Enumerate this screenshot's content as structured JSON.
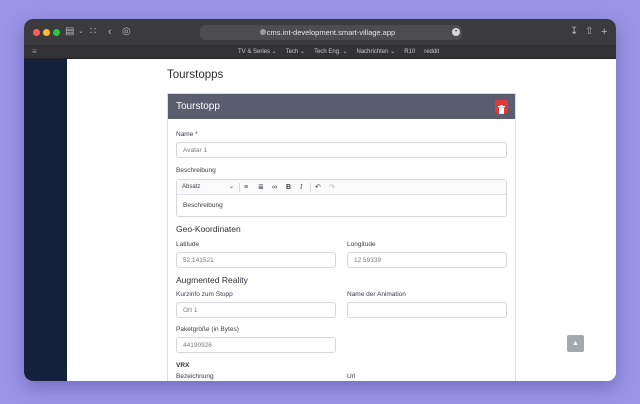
{
  "browser": {
    "url": "cms.int-development.smart-village.app",
    "bookmarks": [
      {
        "label": "TV & Series ⌄"
      },
      {
        "label": "Tech ⌄"
      },
      {
        "label": "Tech Eng. ⌄"
      },
      {
        "label": "Nachrichten ⌄"
      },
      {
        "label": "R10"
      },
      {
        "label": "reddit"
      }
    ]
  },
  "page": {
    "title": "Tourstopps"
  },
  "card": {
    "title": "Tourstopp",
    "name_label": "Name *",
    "name_value": "Avatar 1",
    "beschreibung_label": "Beschreibung",
    "editor_format": "Absatz",
    "editor_body": "Beschreibung",
    "geo_heading": "Geo-Koordinaten",
    "latitude_label": "Latitude",
    "latitude_value": "52.141521",
    "longitude_label": "Longitude",
    "longitude_value": "12.59339",
    "ar_heading": "Augmented Reality",
    "kurzinfo_label": "Kurzinfo zum Stopp",
    "kurzinfo_value": "Ort 1",
    "animation_label": "Name der Animation",
    "animation_value": "",
    "paket_label": "Paketgröße (in Bytes)",
    "paket_value": "44190926",
    "vrx_heading": "VRX",
    "bezeichnung_label": "Bezeichnung",
    "url_label": "Url"
  },
  "colors": {
    "accent": "#e03a3a",
    "card_header": "#5a5d6e",
    "sidebar": "#15213a"
  }
}
